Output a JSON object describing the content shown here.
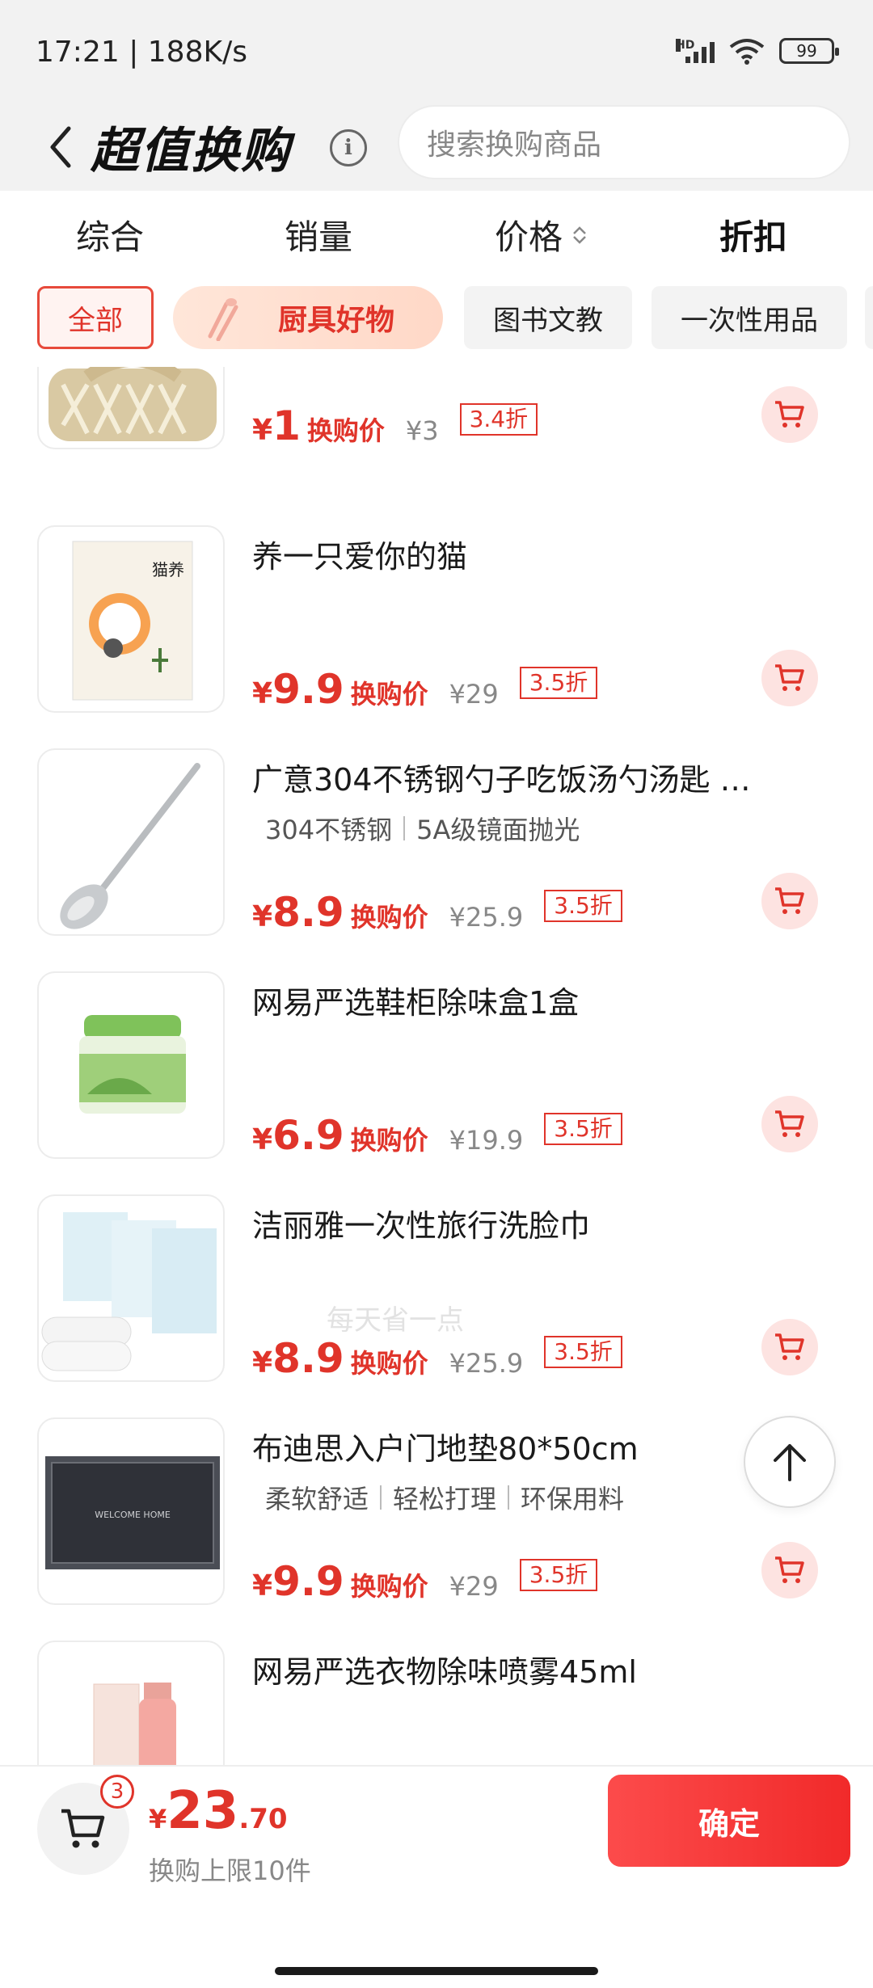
{
  "status_bar": {
    "time": "17:21",
    "speed": "188K/s",
    "network": "HD",
    "battery": "99"
  },
  "header": {
    "title": "超值换购",
    "info": "i",
    "search_placeholder": "搜索换购商品"
  },
  "sort_tabs": [
    {
      "label": "综合"
    },
    {
      "label": "销量"
    },
    {
      "label": "价格"
    },
    {
      "label": "折扣"
    }
  ],
  "chips": [
    {
      "label": "全部"
    },
    {
      "label": "厨具好物"
    },
    {
      "label": "图书文教"
    },
    {
      "label": "一次性用品"
    }
  ],
  "products": [
    {
      "name": "",
      "tags": [],
      "yen": "¥",
      "price": "1",
      "price_label": "换购价",
      "original": "¥3",
      "discount": "3.4折",
      "image": "basket"
    },
    {
      "name": "养一只爱你的猫",
      "tags": [],
      "yen": "¥",
      "price": "9.9",
      "price_label": "换购价",
      "original": "¥29",
      "discount": "3.5折",
      "image": "book"
    },
    {
      "name": "广意304不锈钢勺子吃饭汤勺汤匙 …",
      "tags": [
        "304不锈钢",
        "5A级镜面抛光"
      ],
      "yen": "¥",
      "price": "8.9",
      "price_label": "换购价",
      "original": "¥25.9",
      "discount": "3.5折",
      "image": "spoon"
    },
    {
      "name": "网易严选鞋柜除味盒1盒",
      "tags": [],
      "yen": "¥",
      "price": "6.9",
      "price_label": "换购价",
      "original": "¥19.9",
      "discount": "3.5折",
      "image": "deodorizer"
    },
    {
      "name": "洁丽雅一次性旅行洗脸巾",
      "tags": [],
      "yen": "¥",
      "price": "8.9",
      "price_label": "换购价",
      "original": "¥25.9",
      "discount": "3.5折",
      "image": "towel"
    },
    {
      "name": "布迪思入户门地垫80*50cm",
      "tags": [
        "柔软舒适",
        "轻松打理",
        "环保用料"
      ],
      "yen": "¥",
      "price": "9.9",
      "price_label": "换购价",
      "original": "¥29",
      "discount": "3.5折",
      "image": "doormat",
      "image_text": "WELCOME HOME"
    },
    {
      "name": "网易严选衣物除味喷雾45ml",
      "tags": [],
      "image": "spray"
    }
  ],
  "watermark": "每天省一点",
  "bottom_bar": {
    "cart_count": "3",
    "yen": "¥",
    "total_int": "23",
    "total_dec": ".70",
    "limit_text": "换购上限10件",
    "confirm_label": "确定"
  },
  "colors": {
    "accent": "#e0342a",
    "chip_bg": "#f3f3f3",
    "cart_bg": "#fde3e1"
  }
}
